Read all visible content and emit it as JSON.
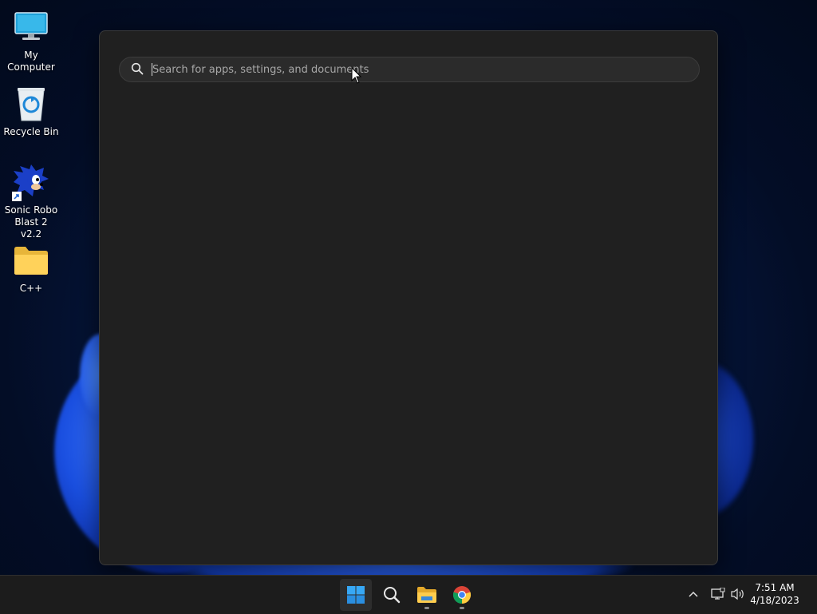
{
  "desktop": {
    "icons": [
      {
        "label": "My Computer",
        "icon": "monitor-icon"
      },
      {
        "label": "Recycle Bin",
        "icon": "recycle-bin-icon"
      },
      {
        "label": "Sonic Robo Blast 2 v2.2",
        "icon": "sonic-shortcut-icon"
      },
      {
        "label": "C++",
        "icon": "folder-icon"
      }
    ]
  },
  "start_menu": {
    "search": {
      "placeholder": "Search for apps, settings, and documents",
      "value": ""
    }
  },
  "taskbar": {
    "pinned": [
      {
        "name": "Start",
        "icon": "windows-start-icon",
        "active": true
      },
      {
        "name": "Search",
        "icon": "search-icon",
        "active": false
      },
      {
        "name": "File Explorer",
        "icon": "file-explorer-icon",
        "active": false
      },
      {
        "name": "Google Chrome",
        "icon": "chrome-icon",
        "active": false
      }
    ],
    "tray": {
      "icons": [
        "chevron-up-icon",
        "network-icon",
        "volume-icon"
      ],
      "time": "7:51 AM",
      "date": "4/18/2023"
    }
  },
  "colors": {
    "accent": "#0078d4",
    "panel_bg": "#202020",
    "taskbar_bg": "#1c1c1c"
  }
}
